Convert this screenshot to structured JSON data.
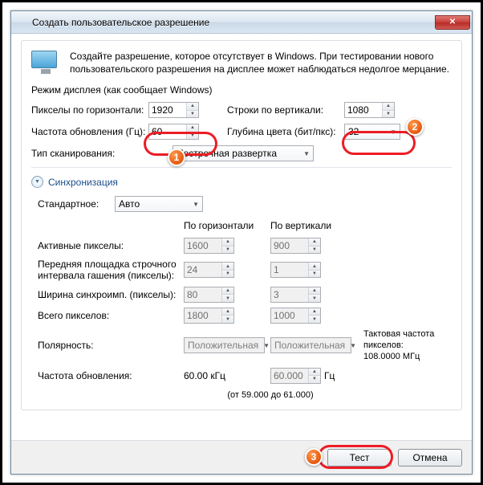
{
  "window": {
    "title": "Создать пользовательское разрешение",
    "close_icon": "✕"
  },
  "intro": "Создайте разрешение, которое отсутствует в Windows. При тестировании нового пользовательского разрешения на дисплее может наблюдаться недолгое мерцание.",
  "mode_title": "Режим дисплея (как сообщает Windows)",
  "fields": {
    "hpixels_label": "Пикселы по горизонтали:",
    "hpixels_value": "1920",
    "vlines_label": "Строки по вертикали:",
    "vlines_value": "1080",
    "refresh_label": "Частота обновления (Гц):",
    "refresh_value": "60",
    "depth_label": "Глубина цвета (бит/пкс):",
    "depth_value": "32",
    "scan_label": "Тип сканирования:",
    "scan_value": "Построчная развертка"
  },
  "sync": {
    "header": "Синхронизация",
    "std_label": "Стандартное:",
    "std_value": "Авто",
    "col_h": "По горизонтали",
    "col_v": "По вертикали",
    "active_label": "Активные пикселы:",
    "active_h": "1600",
    "active_v": "900",
    "fporch_label": "Передняя площадка строчного интервала гашения (пикселы):",
    "fporch_h": "24",
    "fporch_v": "1",
    "syncw_label": "Ширина синхроимп. (пикселы):",
    "syncw_h": "80",
    "syncw_v": "3",
    "total_label": "Всего пикселов:",
    "total_h": "1800",
    "total_v": "1000",
    "polarity_label": "Полярность:",
    "polarity_h": "Положительная",
    "polarity_v": "Положительная",
    "refresh2_label": "Частота обновления:",
    "refresh2_h": "60.00 кГц",
    "refresh2_v": "60.000",
    "hz": "Гц",
    "range": "(от 59.000 до 61.000)",
    "clock_label": "Тактовая частота пикселов:",
    "clock_value": "108.0000 МГц"
  },
  "buttons": {
    "test": "Тест",
    "cancel": "Отмена"
  },
  "badges": {
    "b1": "1",
    "b2": "2",
    "b3": "3"
  }
}
